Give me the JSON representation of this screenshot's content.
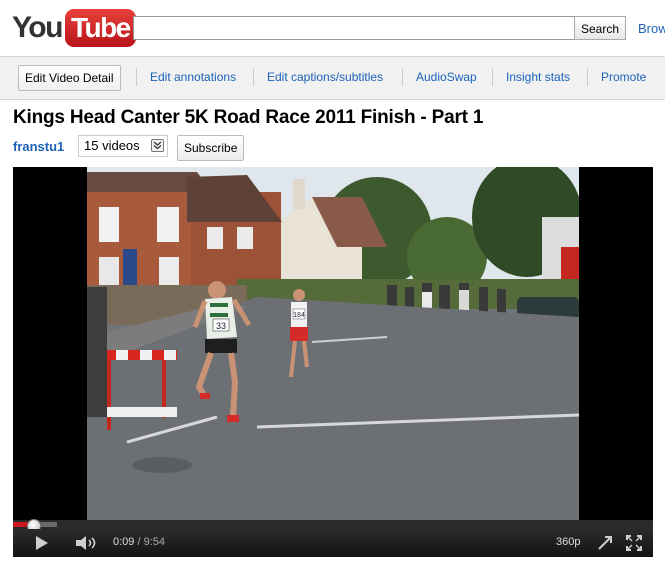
{
  "header": {
    "logo_you": "You",
    "logo_tube": "Tube",
    "search": {
      "value": "",
      "button": "Search"
    },
    "browse": "Browse"
  },
  "owner_bar": {
    "edit_detail": "Edit Video Detail",
    "links": [
      "Edit annotations",
      "Edit captions/subtitles",
      "AudioSwap",
      "Insight stats",
      "Promote"
    ]
  },
  "video": {
    "title": "Kings Head Canter 5K Road Race 2011 Finish - Part 1",
    "channel": "franstu1",
    "video_count": "15 videos",
    "subscribe": "Subscribe"
  },
  "player": {
    "current_time": "0:09",
    "duration": "9:54",
    "quality": "360p",
    "progress_fraction": 0.015,
    "bib_left": "33",
    "bib_right": "184"
  },
  "colors": {
    "brand_red": "#cc181e",
    "link_blue": "#1c62b9"
  }
}
